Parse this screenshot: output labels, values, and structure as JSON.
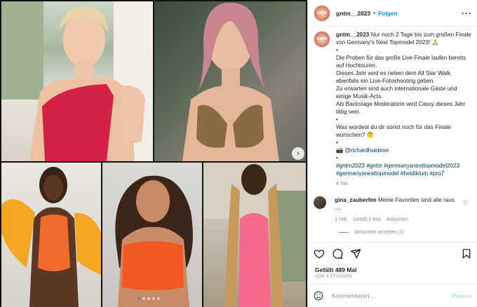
{
  "media": {
    "nav_arrow": "›",
    "dots_count": 5,
    "active_dot": 0
  },
  "header": {
    "username": "gntm__2023",
    "separator": "•",
    "follow_label": "Folgen",
    "more_icon": "more-horizontal-icon"
  },
  "caption": {
    "username": "gntm__2023",
    "line1": "Nur noch 2 Tage bis zum großen Finale von Germany's Next Topmodel 2023! 🙏",
    "bullet1": "•",
    "para1": "Die Proben für das große Live Finale laufen bereits auf Hochtouren.",
    "para2": "Dieses Jahr wird es neben dem All Star Walk ebenfalls ein Live-Fotoshooting geben.",
    "para3": "Zu erwarten sind auch internationale Gäste und einige Musik-Acts.",
    "para4": "Als Backstage Moderatorin wird Cassy dieses Jahr tätig sein.",
    "bullet2": "•",
    "question": "Was würdest du dir sonst noch für das Finale wünschen? 🤔",
    "bullet3": "•",
    "camera_credit": "📸 @richardhuebner",
    "bullet4": "•",
    "hashtags": "#gntm2023 #gntm #germanysnexttopmodel2023 #germanysnexttopmodel #heidiklum #pro7",
    "time": "4 Std."
  },
  "comment": {
    "username": "gina_zauberfee",
    "text": "Meine Favoriten sind alle raus ....",
    "time": "3 Std.",
    "likes": "Gefällt 6 Mal",
    "reply_label": "Antworten",
    "view_replies": "Antworten ansehen (1)"
  },
  "post_meta": {
    "likes": "Gefällt 489 Mal",
    "timestamp": "VOR 4 STUNDEN"
  },
  "add_comment": {
    "placeholder": "Kommentieren ...",
    "post_label": "Posten"
  },
  "colors": {
    "accent": "#0095f6",
    "post_disabled": "#b2dffc",
    "muted": "#8e8e8e"
  }
}
